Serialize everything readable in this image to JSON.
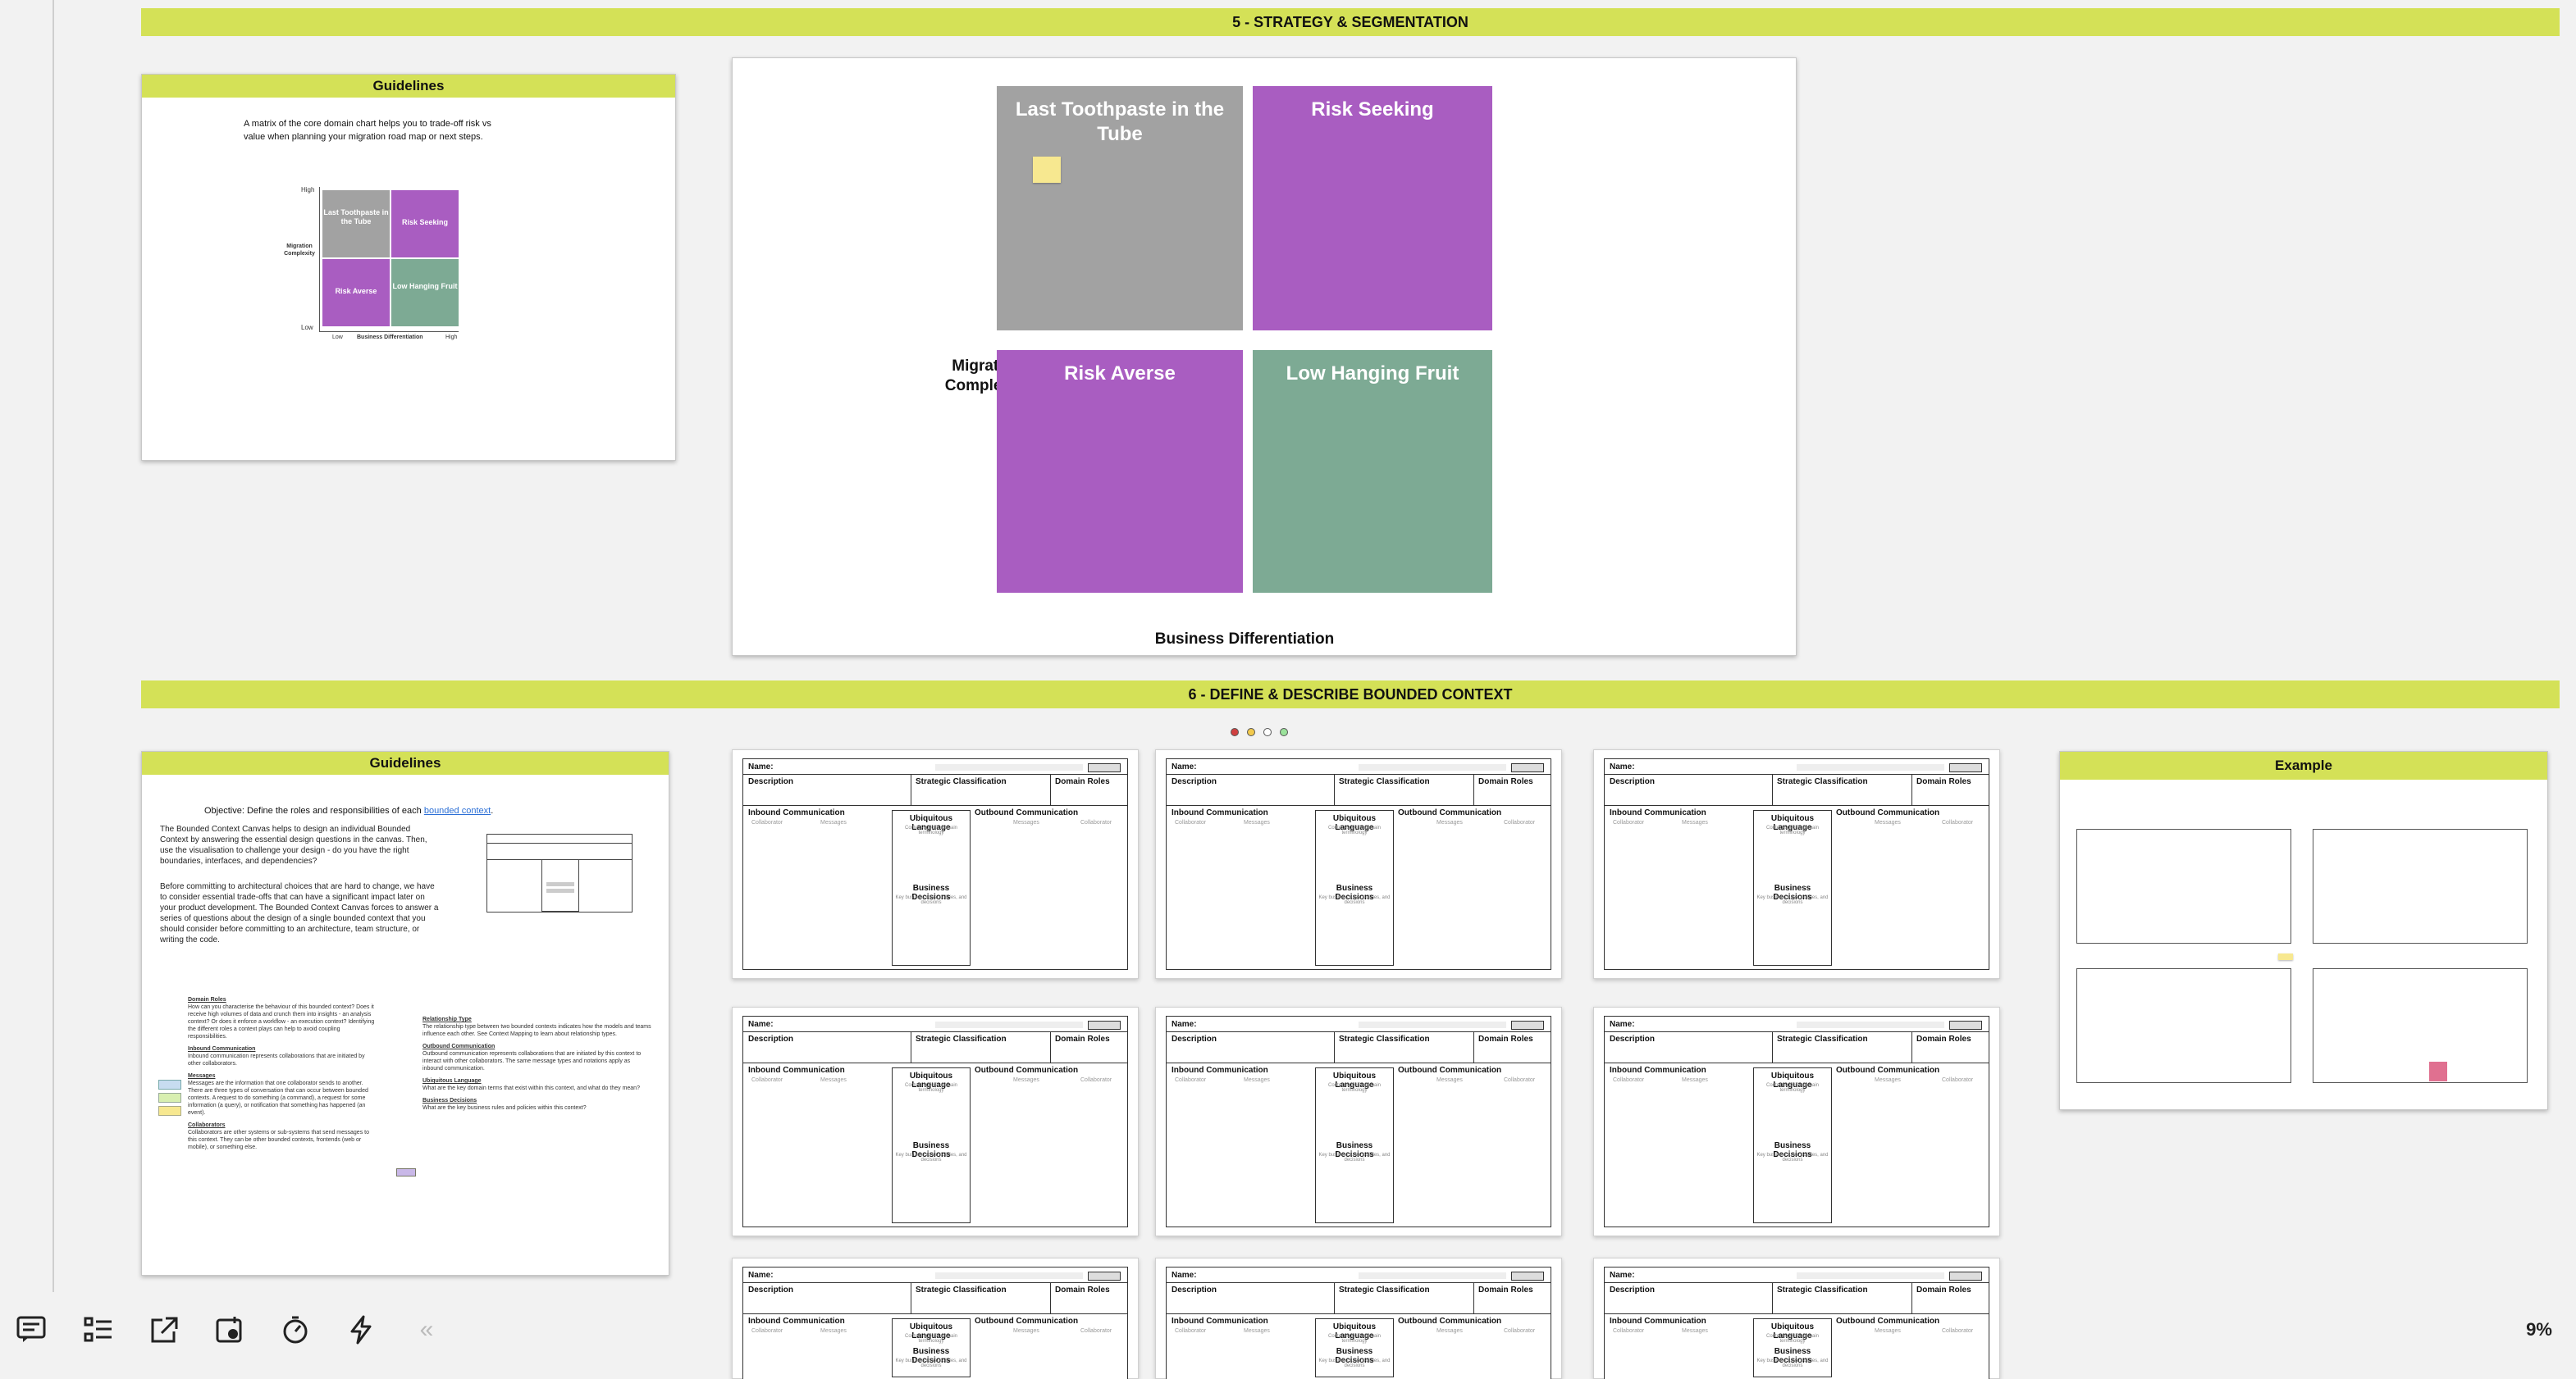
{
  "sections": {
    "strategy": "5 - STRATEGY & SEGMENTATION",
    "define": "6 - DEFINE & DESCRIBE BOUNDED CONTEXT"
  },
  "guidelines1": {
    "title": "Guidelines",
    "text_line1": "A matrix of the core domain chart helps you to trade-off risk vs",
    "text_line2": "value when planning your migration road map or next steps.",
    "mini_chart": {
      "high": "High",
      "low": "Low",
      "low_x": "Low",
      "high_x": "High",
      "y_label_line1": "Migration",
      "y_label_line2": "Complexity",
      "x_label": "Business Differentiation",
      "q1": "Last Toothpaste in the Tube",
      "q2": "Risk Seeking",
      "q3": "Risk Averse",
      "q4": "Low Hanging Fruit"
    }
  },
  "matrix": {
    "y_label_line1": "Migration",
    "y_label_line2": "Complexity",
    "x_label": "Business Differentiation",
    "q1": "Last Toothpaste in the Tube",
    "q2": "Risk Seeking",
    "q3": "Risk Averse",
    "q4": "Low Hanging Fruit"
  },
  "guidelines2": {
    "title": "Guidelines",
    "objective_prefix": "Objective: Define the roles and responsibilities of each ",
    "objective_link": "bounded context",
    "objective_suffix": ".",
    "para1": "The Bounded Context Canvas helps to design an individual Bounded Context by answering the essential design questions in the canvas. Then, use the visualisation to challenge your design - do you have the right boundaries, interfaces, and dependencies?",
    "para2": "Before committing to architectural choices that are hard to change, we have to consider essential trade-offs that can have a significant impact later on your product development. The Bounded Context Canvas forces to answer a series of questions about the design of a single bounded context that you should consider before committing to an architecture, team structure, or writing the code.",
    "left_items": [
      {
        "h": "Domain Roles",
        "t": "How can you characterise the behaviour of this bounded context? Does it receive high volumes of data and crunch them into insights - an analysis context? Or does it enforce a workflow - an execution context? Identifying the different roles a context plays can help to avoid coupling responsibilities."
      },
      {
        "h": "Inbound Communication",
        "t": "Inbound communication represents collaborations that are initiated by other collaborators."
      },
      {
        "h": "Messages",
        "t": "Messages are the information that one collaborator sends to another. There are three types of conversation that can occur between bounded contexts. A request to do something (a command), a request for some information (a query), or notification that something has happened (an event)."
      },
      {
        "h": "Collaborators",
        "t": "Collaborators are other systems or sub-systems that send messages to this context. They can be other bounded contexts, frontends (web or mobile), or something else."
      }
    ],
    "right_items": [
      {
        "h": "Relationship Type",
        "t": "The relationship type between two bounded contexts indicates how the models and teams influence each other. See Context Mapping to learn about relationship types."
      },
      {
        "h": "Outbound Communication",
        "t": "Outbound communication represents collaborations that are initiated by this context to interact with other collaborators. The same message types and notations apply as inbound communication."
      },
      {
        "h": "Ubiquitous Language",
        "t": "What are the key domain terms that exist within this context, and what do they mean?"
      },
      {
        "h": "Business Decisions",
        "t": "What are the key business rules and policies within this context?"
      }
    ]
  },
  "canvas_template": {
    "name": "Name:",
    "description": "Description",
    "strategic": "Strategic Classification",
    "domain_roles": "Domain Roles",
    "inbound": "Inbound Communication",
    "outbound": "Outbound Communication",
    "collaborator": "Collaborator",
    "messages": "Messages",
    "ubiquitous": "Ubiquitous Language",
    "ubiquitous_sub": "Context-specific domain terminology",
    "business": "Business Decisions",
    "business_sub": "Key business rules, policies, and decisions"
  },
  "example": {
    "title": "Example"
  },
  "toolbar": {
    "zoom": "9%",
    "collapse": "«"
  },
  "colors": {
    "accent": "#d4e157",
    "purple": "#a95dc1",
    "grey": "#a2a2a2",
    "green": "#7daa94"
  }
}
